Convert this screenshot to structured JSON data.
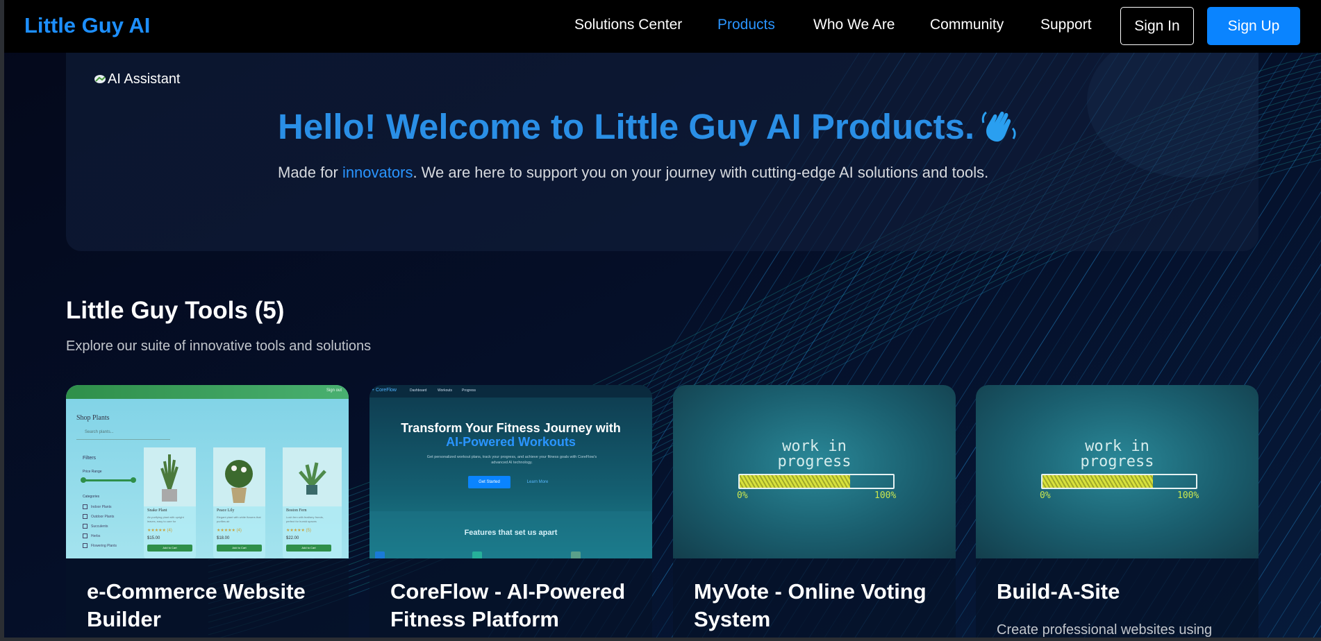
{
  "nav": {
    "logo": "Little Guy AI",
    "links": [
      "Solutions Center",
      "Products",
      "Who We Are",
      "Community",
      "Support"
    ],
    "active_link": "Products",
    "sign_in": "Sign In",
    "sign_up": "Sign Up"
  },
  "hero": {
    "assistant_alt": "AI Assistant",
    "title": "Hello! Welcome to Little Guy AI Products.",
    "subtitle_prefix": "Made for ",
    "subtitle_highlight": "innovators",
    "subtitle_suffix": ". We are here to support you on your journey with cutting-edge AI solutions and tools."
  },
  "tools": {
    "title": "Little Guy Tools (5)",
    "subtitle": "Explore our suite of innovative tools and solutions",
    "cards": [
      {
        "title": "e-Commerce Website Builder",
        "thumb": {
          "top_label": "Sign out",
          "shop_title": "Shop Plants",
          "search_placeholder": "Search plants...",
          "filters": "Filters",
          "price_range": "Price Range",
          "categories": "Categories",
          "category_items": [
            "Indoor Plants",
            "Outdoor Plants",
            "Succulents",
            "Herbs",
            "Flowering Plants"
          ],
          "products": [
            {
              "name": "Snake Plant",
              "desc": "Air-purifying plant with upright leaves, easy to care for",
              "stars": "★★★★★ (4)",
              "price": "$15.00",
              "button": "Add to Cart"
            },
            {
              "name": "Peace Lily",
              "desc": "Elegant plant with white flowers that purifies air",
              "stars": "★★★★★ (4)",
              "price": "$18.00",
              "button": "Add to Cart"
            },
            {
              "name": "Boston Fern",
              "desc": "Lush fern with feathery fronds, perfect for humid spaces",
              "stars": "★★★★★ (5)",
              "price": "$22.00",
              "button": "Add to Cart"
            }
          ]
        }
      },
      {
        "title": "CoreFlow - AI-Powered Fitness Platform",
        "thumb": {
          "brand": "+ CoreFlow",
          "nav_links": [
            "Dashboard",
            "Workouts",
            "Progress"
          ],
          "headline_1": "Transform Your Fitness Journey with",
          "headline_2": "AI-Powered Workouts",
          "para": "Get personalized workout plans, track your progress, and achieve your fitness goals with CoreFlow's advanced AI technology.",
          "btn_primary": "Get Started",
          "btn_secondary": "Learn More",
          "features": "Features that set us apart"
        }
      },
      {
        "title": "MyVote - Online Voting System",
        "thumb": {
          "line1": "work in",
          "line2": "progress",
          "progress": 0.72,
          "min_label": "0%",
          "max_label": "100%"
        }
      },
      {
        "title": "Build-A-Site",
        "desc": "Create professional websites using",
        "thumb": {
          "line1": "work in",
          "line2": "progress",
          "progress": 0.72,
          "min_label": "0%",
          "max_label": "100%"
        }
      }
    ]
  }
}
